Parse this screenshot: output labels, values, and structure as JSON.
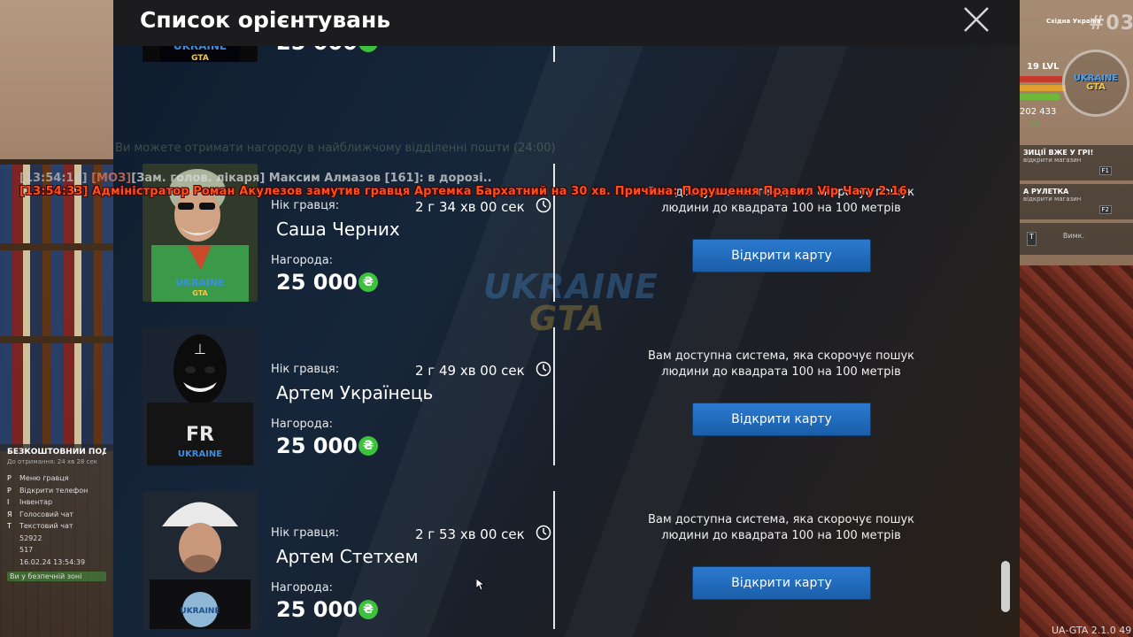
{
  "panel": {
    "title": "Список орієнтувань"
  },
  "labels": {
    "nick": "Нік гравця:",
    "reward": "Нагорода:",
    "description": "Вам доступна система, яка скорочує пошук людини до квадрата 100 на 100 метрів",
    "map_button": "Відкрити карту"
  },
  "cards": [
    {
      "name": "",
      "timer": "",
      "reward": "25 000",
      "currency": "₴"
    },
    {
      "name": "Саша Черних",
      "timer": "2 г 34 хв 00 сек",
      "reward": "25 000",
      "currency": "₴"
    },
    {
      "name": "Артем Українець",
      "timer": "2 г 49 хв 00 сек",
      "reward": "25 000",
      "currency": "₴"
    },
    {
      "name": "Артем Стетхем",
      "timer": "2 г 53 хв 00 сек",
      "reward": "25 000",
      "currency": "₴"
    }
  ],
  "watermark": {
    "line1": "UKRAINE",
    "line2": "GTA"
  },
  "chat": {
    "line1_ts": "[13:54:18]",
    "line1_tag": "[МОЗ]",
    "line1_text": "[Зам. голов. лікаря] Максим Алмазов [161]: в дорозі..",
    "line2": "[13:54:33] Адміністратор Роман Акулезов замутив гравця Артемка Бархатний на 30 хв. Причина: Порушення Правил Vip Чату 2.16",
    "faint": "Ви можете отримати нагороду в найближчому відділенні пошти (24:00)"
  },
  "hud_left": {
    "gift_title": "БЕЗКОШТОВНИЙ ПОДАРУНОК",
    "gift_sub": "До отримання: 24 хв 28 сек",
    "items": [
      {
        "key": "P",
        "label": "Меню гравця"
      },
      {
        "key": "P",
        "label": "Відкрити телефон"
      },
      {
        "key": "I",
        "label": "Інвентар"
      },
      {
        "key": "Я",
        "label": "Голосовий чат"
      },
      {
        "key": "T",
        "label": "Текстовий чат"
      },
      {
        "key": "",
        "label": "52922"
      },
      {
        "key": "",
        "label": "517"
      },
      {
        "key": "",
        "label": "16.02.24 13:54:39"
      }
    ],
    "safe_zone": "Ви у безпечній зоні"
  },
  "hud_right": {
    "server": "Східна Україна",
    "server_num": "#03",
    "level": "19 LVL",
    "money": "202 433",
    "mini": "37",
    "promo1_title": "ЗИЦІЇ ВЖЕ У ГРІ!",
    "promo1_sub": "відкрити магазин",
    "promo1_key": "F1",
    "promo2_title": "А РУЛЕТКА",
    "promo2_sub": "відкрити магазин",
    "promo2_key": "F2",
    "toggle_key": "T",
    "toggle_label": "Вимк.",
    "logo_line1": "UKRAINE",
    "logo_line2": "GTA"
  },
  "version": "UA-GTA 2.1.0 49",
  "colors": {
    "button": "#1a5ea8",
    "coin": "#3cc23c",
    "chat_alert": "#ff4d1a",
    "header": "#1c1c1e"
  }
}
